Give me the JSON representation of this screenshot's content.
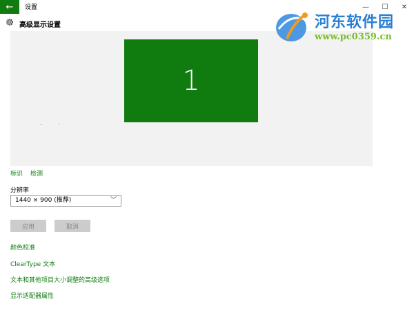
{
  "window": {
    "title": "设置",
    "back_glyph": "←",
    "minimize_glyph": "—",
    "maximize_glyph": "☐",
    "close_glyph": "✕"
  },
  "header": {
    "title": "高级显示设置",
    "icon": "gear-icon"
  },
  "preview": {
    "monitor_number": "1",
    "monitor_color": "#107c10"
  },
  "links_top": {
    "identify": "标识",
    "detect": "检测"
  },
  "resolution": {
    "label": "分辨率",
    "value": "1440 × 900 (推荐)",
    "chevron": "﹀"
  },
  "buttons": {
    "apply": "应用",
    "cancel": "取消"
  },
  "links": [
    "颜色校准",
    "ClearType 文本",
    "文本和其他项目大小调整的高级选项",
    "显示适配器属性"
  ],
  "watermark": {
    "name": "河东软件园",
    "url": "www.pc0359.cn"
  },
  "colors": {
    "accent": "#107c10",
    "preview_bg": "#f2f2f2",
    "disabled_button": "#cccccc"
  }
}
